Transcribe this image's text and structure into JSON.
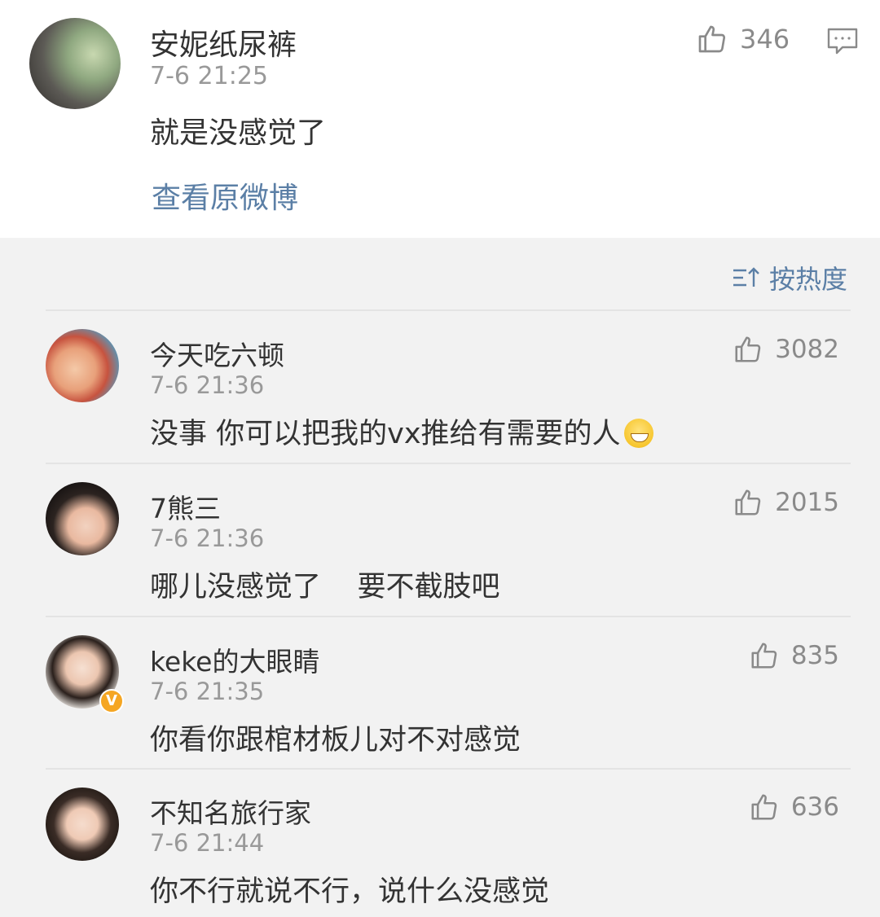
{
  "post": {
    "author": "安妮纸尿裤",
    "time": "7-6 21:25",
    "text": "就是没感觉了",
    "likes": "346",
    "view_original": "查看原微博"
  },
  "sort": {
    "label": "按热度"
  },
  "comments": [
    {
      "name": "今天吃六顿",
      "time": "7-6 21:36",
      "text": "没事 你可以把我的vx推给有需要的人",
      "likes": "3082"
    },
    {
      "name": "7熊三",
      "time": "7-6 21:36",
      "text": "哪儿没感觉了    要不截肢吧",
      "likes": "2015"
    },
    {
      "name": "keke的大眼睛",
      "time": "7-6 21:35",
      "text": "你看你跟棺材板儿对不对感觉",
      "likes": "835"
    },
    {
      "name": "不知名旅行家",
      "time": "7-6 21:44",
      "text": "你不行就说不行，说什么没感觉",
      "likes": "636"
    }
  ],
  "colors": {
    "link": "#5b7fa6",
    "muted": "#999999",
    "text": "#333333",
    "background": "#f2f2f2"
  }
}
